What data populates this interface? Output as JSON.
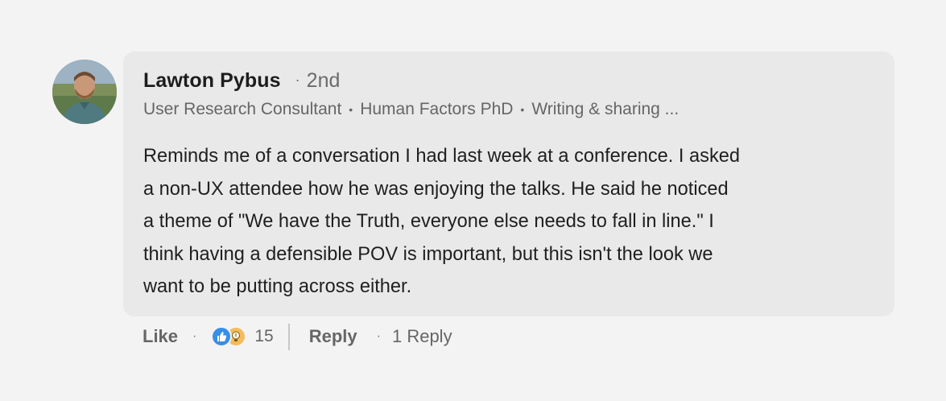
{
  "comment": {
    "author": {
      "name": "Lawton Pybus",
      "degree": "2nd",
      "headline_parts": [
        "User Research Consultant",
        "Human Factors PhD",
        "Writing & sharing ..."
      ]
    },
    "text_lines": [
      "Reminds me of a conversation I had last week at a conference. I asked",
      "a non-UX attendee how he was enjoying the talks. He said he noticed",
      "a theme of \"We have the Truth, everyone else needs to fall in line.\" I",
      "think having a defensible POV is important, but this isn't the look we",
      "want to be putting across either."
    ]
  },
  "actions": {
    "like_label": "Like",
    "separator": "·",
    "reaction_icons": [
      "like-icon",
      "insightful-icon"
    ],
    "reaction_count": "15",
    "reply_label": "Reply",
    "replies_label": "1 Reply"
  },
  "colors": {
    "background": "#f4f3f4",
    "bubble": "#e9e9e9",
    "like_blue": "#378fe9",
    "insightful_yellow": "#f5bb5c"
  }
}
